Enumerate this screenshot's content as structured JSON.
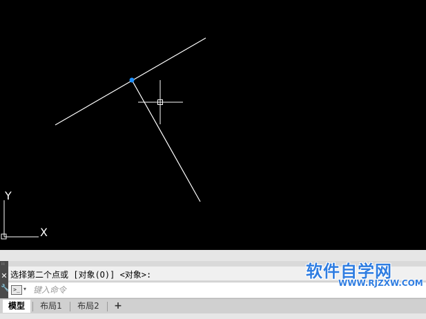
{
  "drawing": {
    "ucs_y_label": "Y",
    "ucs_x_label": "X",
    "colors": {
      "background": "#000000",
      "line": "#ffffff",
      "grip": "#1e90ff",
      "crosshair": "#ffffff"
    }
  },
  "command_line": {
    "history_text": "选择第二个点或 [对象(O)] <对象>:",
    "input_placeholder": "键入命令",
    "prompt_icon": ">_",
    "dropdown_icon": "▾",
    "close_icon": "✕",
    "customize_icon": "🔧"
  },
  "layout_tabs": {
    "tabs": [
      {
        "label": "模型",
        "active": true
      },
      {
        "label": "布局1",
        "active": false
      },
      {
        "label": "布局2",
        "active": false
      }
    ],
    "add_label": "+"
  },
  "watermark": {
    "title": "软件自学网",
    "url": "WWW.RJZXW.COM"
  }
}
